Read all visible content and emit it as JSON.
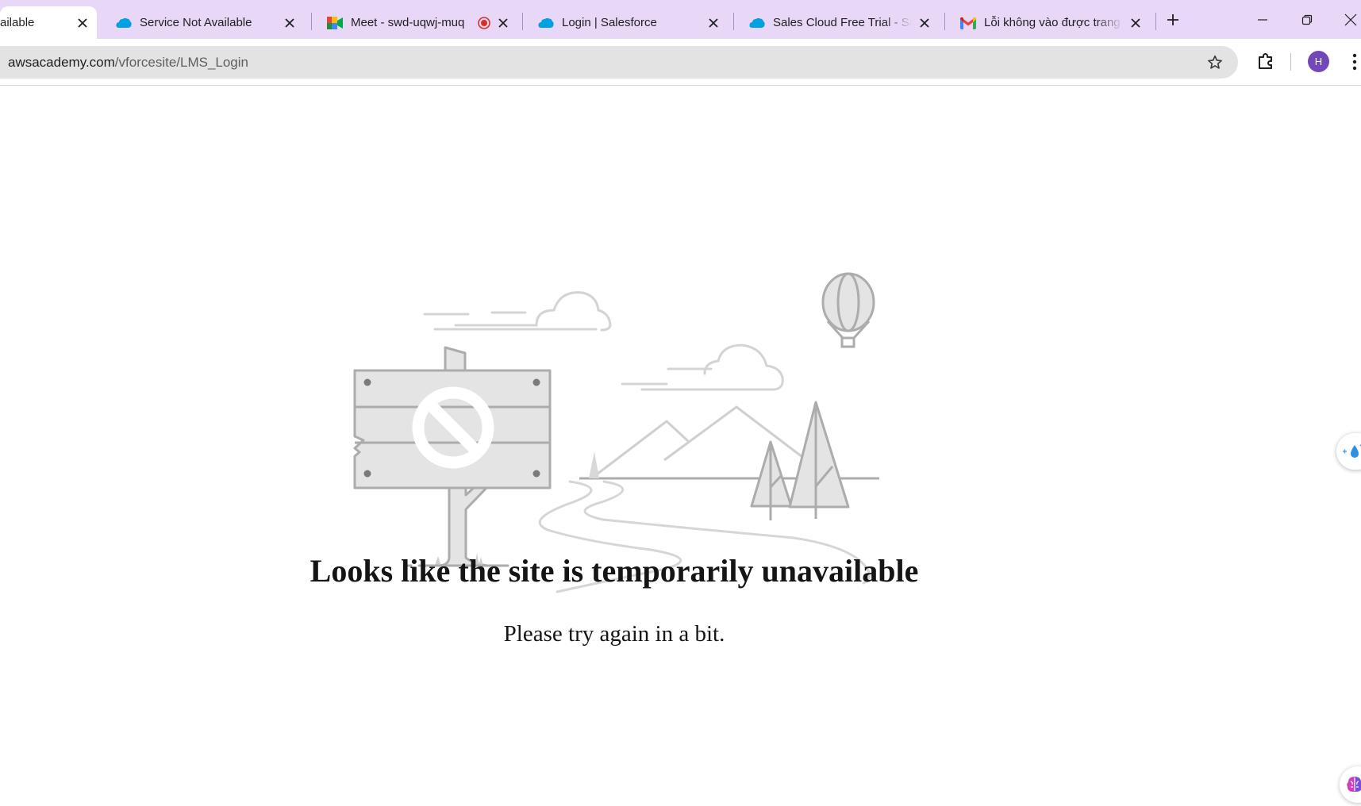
{
  "browser": {
    "tabs": [
      {
        "title": "ailable",
        "favicon": "salesforce-cloud-icon",
        "active": true
      },
      {
        "title": "Service Not Available",
        "favicon": "salesforce-cloud-icon"
      },
      {
        "title": "Meet - swd-uqwj-muq",
        "favicon": "google-meet-icon",
        "recording": true
      },
      {
        "title": "Login | Salesforce",
        "favicon": "salesforce-cloud-icon"
      },
      {
        "title": "Sales Cloud Free Trial - Sal",
        "favicon": "salesforce-cloud-icon"
      },
      {
        "title": "Lỗi không vào được trang",
        "favicon": "gmail-icon"
      }
    ],
    "address": {
      "host": "awsacademy.com",
      "path": "/vforcesite/LMS_Login"
    },
    "profile_initial": "H",
    "colors": {
      "tabstrip": "#e8d7f7",
      "omnibox": "#e3e3e3",
      "avatar": "#7248b9",
      "salesforce": "#00a1e0",
      "record": "#d93025"
    }
  },
  "page": {
    "headline": "Looks like the site is temporarily unavailable",
    "subtext": "Please try again in a bit."
  }
}
